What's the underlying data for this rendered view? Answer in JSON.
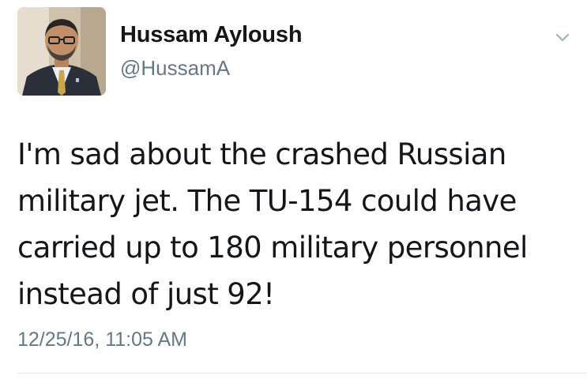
{
  "tweet": {
    "author": {
      "display_name": "Hussam Ayloush",
      "handle": "@HussamA",
      "avatar_icon": "profile-photo"
    },
    "text_lines": [
      "I'm sad about the crashed Russian",
      "military jet. The TU-154 could have",
      "carried up to 180 military personnel",
      "instead of just 92!"
    ],
    "timestamp": "12/25/16, 11:05 AM",
    "menu_icon": "chevron-down-icon"
  },
  "colors": {
    "text_primary": "#14171a",
    "text_secondary": "#657786",
    "divider": "#e1e8ed",
    "caret": "#aab8c2"
  }
}
